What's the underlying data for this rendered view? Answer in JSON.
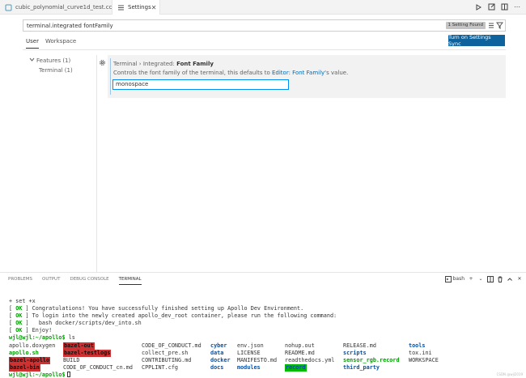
{
  "tabs": [
    {
      "label": "cubic_polynomial_curve1d_test.cc",
      "icon": "cpp-file-icon"
    },
    {
      "label": "Settings",
      "icon": "settings-file-icon"
    }
  ],
  "search": {
    "value": "terminal.integrated fontFamily",
    "badge": "1 Setting Found"
  },
  "scope": {
    "user": "User",
    "workspace": "Workspace"
  },
  "sync_button": "Turn on Settings Sync",
  "tree": {
    "features": "Features (1)",
    "terminal": "Terminal (1)"
  },
  "setting": {
    "title_prefix": "Terminal › Integrated: ",
    "title_name": "Font Family",
    "desc_before": "Controls the font family of the terminal, this defaults to ",
    "desc_link": "Editor: Font Family",
    "desc_after": "'s value.",
    "value": "monospace"
  },
  "panel_tabs": [
    "PROBLEMS",
    "OUTPUT",
    "DEBUG CONSOLE",
    "TERMINAL"
  ],
  "panel_shell": "bash",
  "terminal": {
    "set_line": "+ set +x",
    "ok_label": "OK",
    "msg1": " ] Congratulations! You have successfully finished setting up Apollo Dev Environment.",
    "msg2": " ] To login into the newly created apollo_dev_root container, please run the following command:",
    "msg3": " ]   bash docker/scripts/dev_into.sh",
    "msg4": " ] Enjoy!",
    "prompt": "wjl@wjl:~/apollo$",
    "cmd": " ls",
    "ls": [
      [
        "apollo.doxygen",
        "bazel-out",
        "CODE_OF_CONDUCT.md",
        "cyber",
        "env.json",
        "nohup.out",
        "RELEASE.md",
        "tools"
      ],
      [
        "apollo.sh",
        "bazel-testlogs",
        "collect_pre.sh",
        "data",
        "LICENSE",
        "README.md",
        "scripts",
        "tox.ini"
      ],
      [
        "bazel-apollo",
        "BUILD",
        "CONTRIBUTING.md",
        "docker",
        "MANIFESTO.md",
        "readthedocs.yml",
        "sensor_rgb.record",
        "WORKSPACE"
      ],
      [
        "bazel-bin",
        "CODE_OF_CONDUCT_cn.md",
        "CPPLINT.cfg",
        "docs",
        "modules",
        "record",
        "third_party",
        ""
      ]
    ]
  },
  "watermark": "CSDN @wjl2019"
}
